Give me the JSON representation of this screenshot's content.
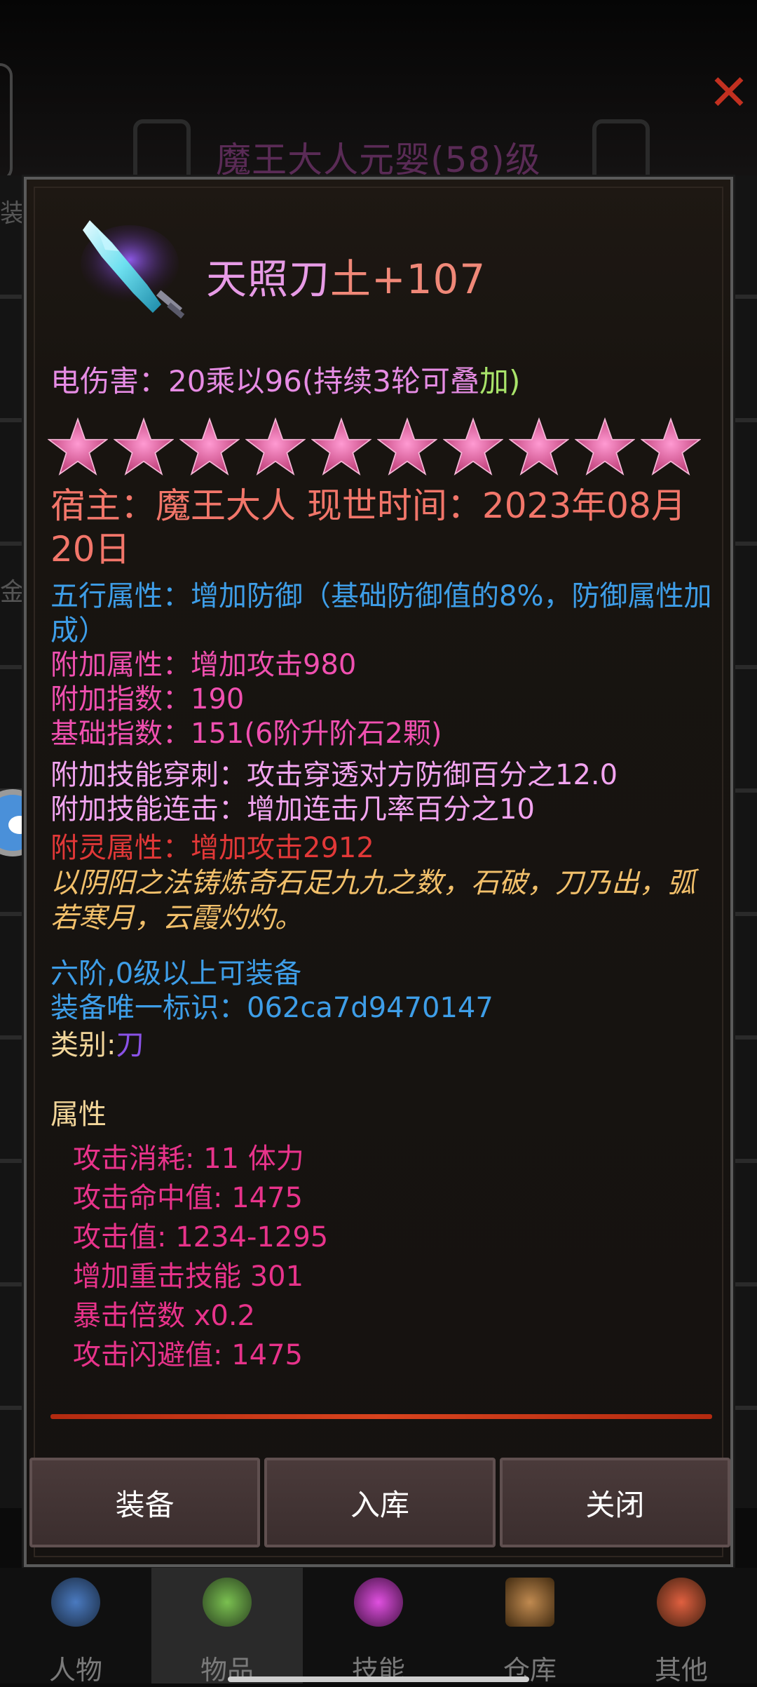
{
  "background": {
    "title": "魔王大人元婴(58)级",
    "side_label_top": "装",
    "side_label_mid": "金"
  },
  "item": {
    "title_head": "天照刀",
    "title_tail": "土+107",
    "elec_damage_main": "电伤害：20乘以96(持续3轮可叠",
    "elec_damage_tail": "加)",
    "stars": 10,
    "owner_line": "宿主：魔王大人 现世时间：2023年08月20日",
    "wuxing": "五行属性：增加防御（基础防御值的8%，防御属性加成）",
    "extra_attr": "附加属性：增加攻击980",
    "extra_index": "附加指数：190",
    "base_index": "基础指数：151(6阶升阶石2颗)",
    "skill_pierce": "附加技能穿刺：攻击穿透对方防御百分之12.0",
    "skill_combo": "附加技能连击：增加连击几率百分之10",
    "spirit_attr": "附灵属性：增加攻击2912",
    "flavor": "以阴阳之法铸炼奇石足九九之数，石破，刀乃出，弧若寒月，云霞灼灼。",
    "requirement": "六阶,0级以上可装备",
    "unique_id": "装备唯一标识：062ca7d9470147",
    "category_label": "类别:",
    "category_value": "刀",
    "attributes_header": "属性",
    "attributes": [
      "攻击消耗: 11  体力",
      "攻击命中值: 1475",
      "攻击值:   1234-1295",
      "增加重击技能  301",
      "暴击倍数  x0.2",
      "攻击闪避值: 1475"
    ]
  },
  "buttons": {
    "equip": "装备",
    "store": "入库",
    "close": "关闭"
  },
  "nav": [
    {
      "label": "人物",
      "icon": "character-icon"
    },
    {
      "label": "物品",
      "icon": "items-icon"
    },
    {
      "label": "技能",
      "icon": "skills-icon"
    },
    {
      "label": "仓库",
      "icon": "warehouse-icon"
    },
    {
      "label": "其他",
      "icon": "other-icon"
    }
  ],
  "colors": {
    "title": "#f08878",
    "elec": "#e68ce4",
    "owner": "#f2766a",
    "wuxing": "#3e9ee8",
    "extra": "#f050b0",
    "spirit": "#e23838",
    "flavor": "#f2c06b",
    "attributes": "#e8338b",
    "divider": "#d8431e"
  }
}
